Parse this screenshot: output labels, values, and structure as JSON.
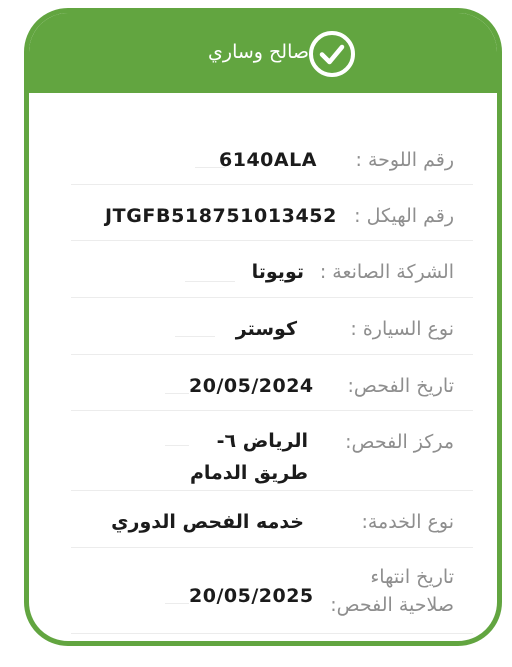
{
  "header": {
    "title": "صالح وساري"
  },
  "fields": [
    {
      "label": "رقم اللوحة :",
      "value": "6140ALA"
    },
    {
      "label": "رقم الهيكل :",
      "value": "JTGFB518751013452"
    },
    {
      "label": "الشركة الصانعة :",
      "value": "تويوتا"
    },
    {
      "label": "نوع السيارة :",
      "value": "كوستر"
    },
    {
      "label": "تاريخ الفحص:",
      "value": "20/05/2024"
    },
    {
      "label": "مركز الفحص:",
      "value": "الرياض ٦- طريق الدمام"
    },
    {
      "label": "نوع الخدمة:",
      "value": "خدمه الفحص الدوري"
    },
    {
      "label": "تاريخ انتهاء صلاحية الفحص:",
      "value": "20/05/2025"
    }
  ],
  "colors": {
    "accent": "#62a540",
    "label": "#8e8e8e",
    "value": "#1b1b1b"
  },
  "icons": {
    "header_icon": "check-circle-icon"
  }
}
